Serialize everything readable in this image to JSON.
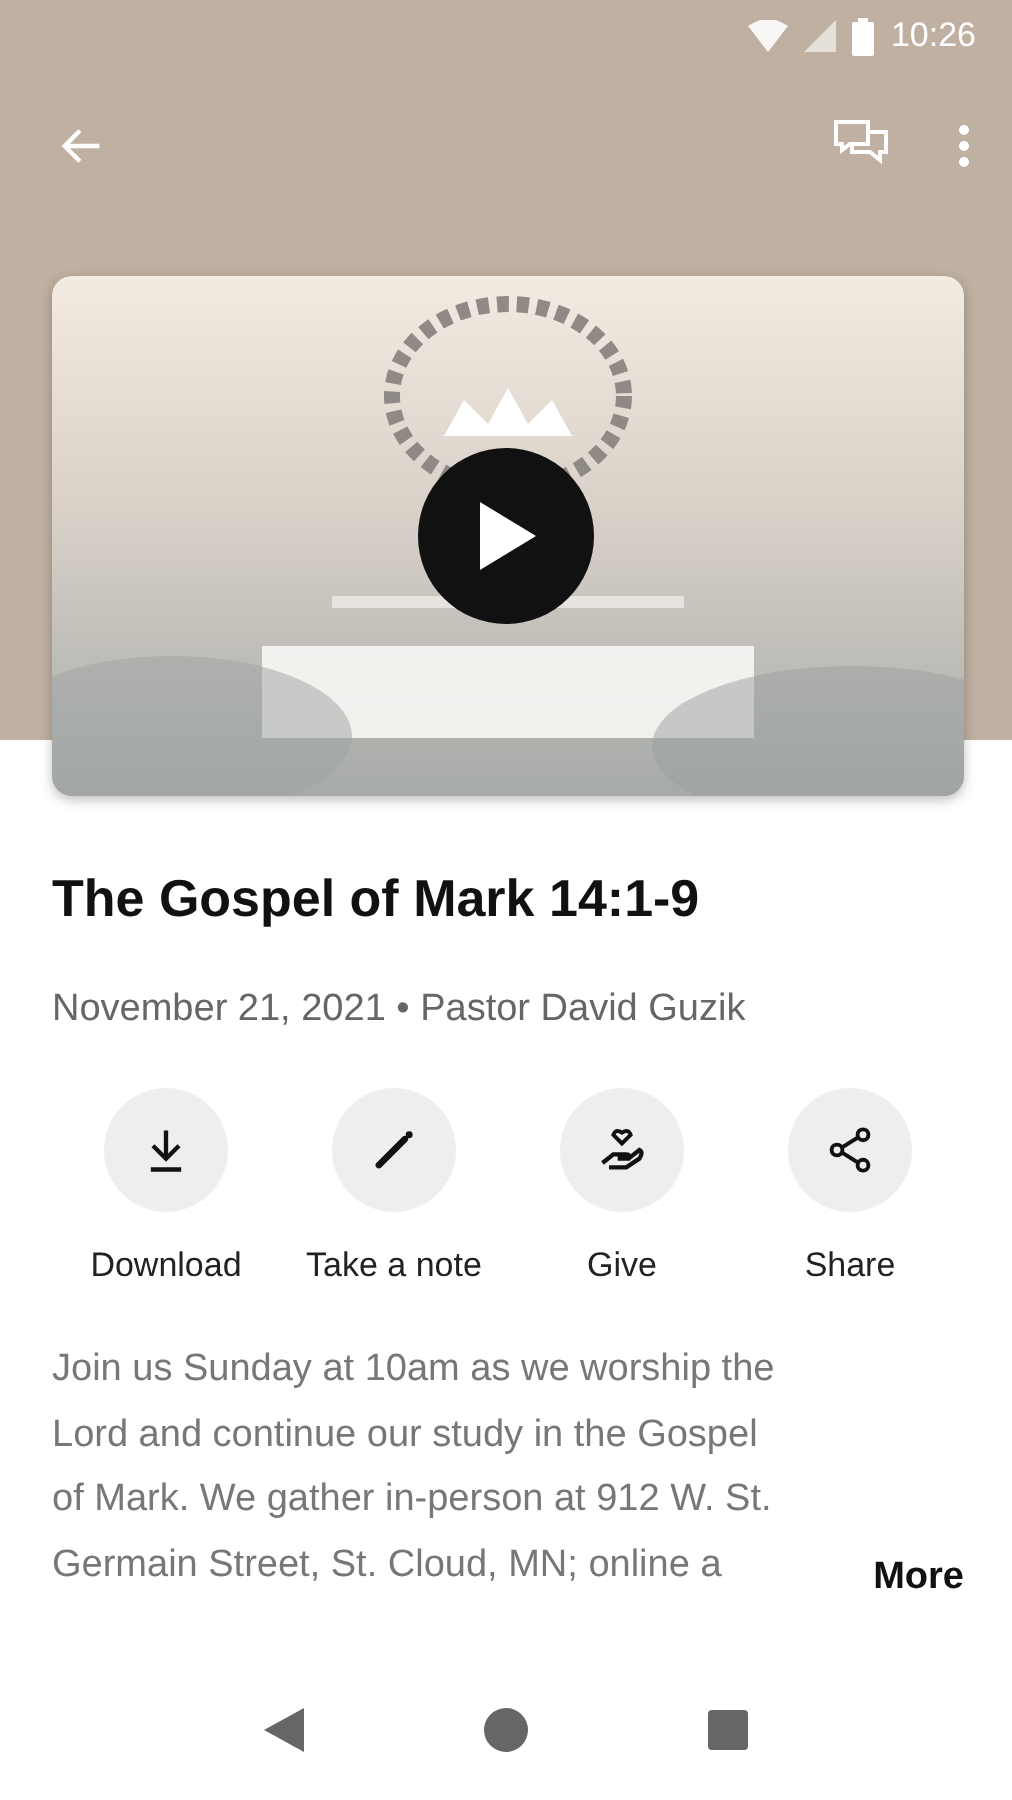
{
  "status_bar": {
    "time": "10:26"
  },
  "title": "The Gospel of Mark 14:1-9",
  "meta": "November 21, 2021 • Pastor David Guzik",
  "actions": [
    {
      "kind": "download",
      "label": "Download"
    },
    {
      "kind": "note",
      "label": "Take a note"
    },
    {
      "kind": "give",
      "label": "Give"
    },
    {
      "kind": "share",
      "label": "Share"
    }
  ],
  "description": [
    "Join us Sunday at 10am as we worship the",
    "Lord and continue our study in the Gospel",
    "of Mark. We gather in-person at 912 W. St.",
    "Germain Street, St. Cloud, MN; online a"
  ],
  "more": "More"
}
